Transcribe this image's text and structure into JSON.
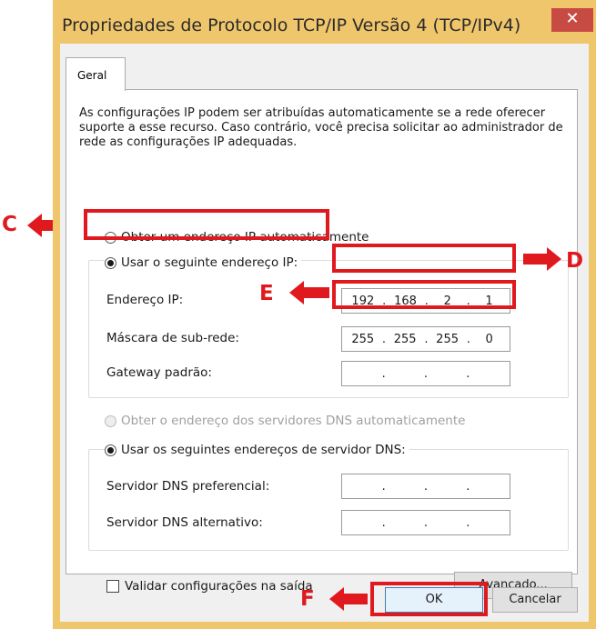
{
  "window": {
    "title": "Propriedades de Protocolo TCP/IP Versão 4 (TCP/IPv4)",
    "close_glyph": "✕"
  },
  "tabs": [
    {
      "label": "Geral"
    }
  ],
  "description": "As configurações IP podem ser atribuídas automaticamente se a rede oferecer suporte a esse recurso. Caso contrário, você precisa solicitar ao administrador de rede as configurações IP adequadas.",
  "ip_section": {
    "auto_option": "Obter um endereço IP automaticamente",
    "manual_option": "Usar o seguinte endereço IP:",
    "manual_selected": true,
    "fields": [
      {
        "label": "Endereço IP:",
        "octets": [
          "192",
          "168",
          "2",
          "1"
        ]
      },
      {
        "label": "Máscara de sub-rede:",
        "octets": [
          "255",
          "255",
          "255",
          "0"
        ]
      },
      {
        "label": "Gateway padrão:",
        "octets": [
          "",
          "",
          "",
          ""
        ]
      }
    ]
  },
  "dns_section": {
    "auto_option": "Obter o endereço dos servidores DNS automaticamente",
    "auto_disabled": true,
    "manual_option": "Usar os seguintes endereços de servidor DNS:",
    "fields": [
      {
        "label": "Servidor DNS preferencial:",
        "octets": [
          "",
          "",
          "",
          ""
        ]
      },
      {
        "label": "Servidor DNS alternativo:",
        "octets": [
          "",
          "",
          "",
          ""
        ]
      }
    ]
  },
  "validate_checkbox": {
    "label": "Validar configurações na saída",
    "checked": false
  },
  "buttons": {
    "advanced": "Avançado...",
    "ok": "OK",
    "cancel": "Cancelar"
  },
  "annotations": {
    "c": "C",
    "d": "D",
    "e": "E",
    "f": "F"
  },
  "colors": {
    "accent_red": "#e0191e",
    "titlebar": "#f0c66c",
    "close_button": "#c74b43"
  }
}
